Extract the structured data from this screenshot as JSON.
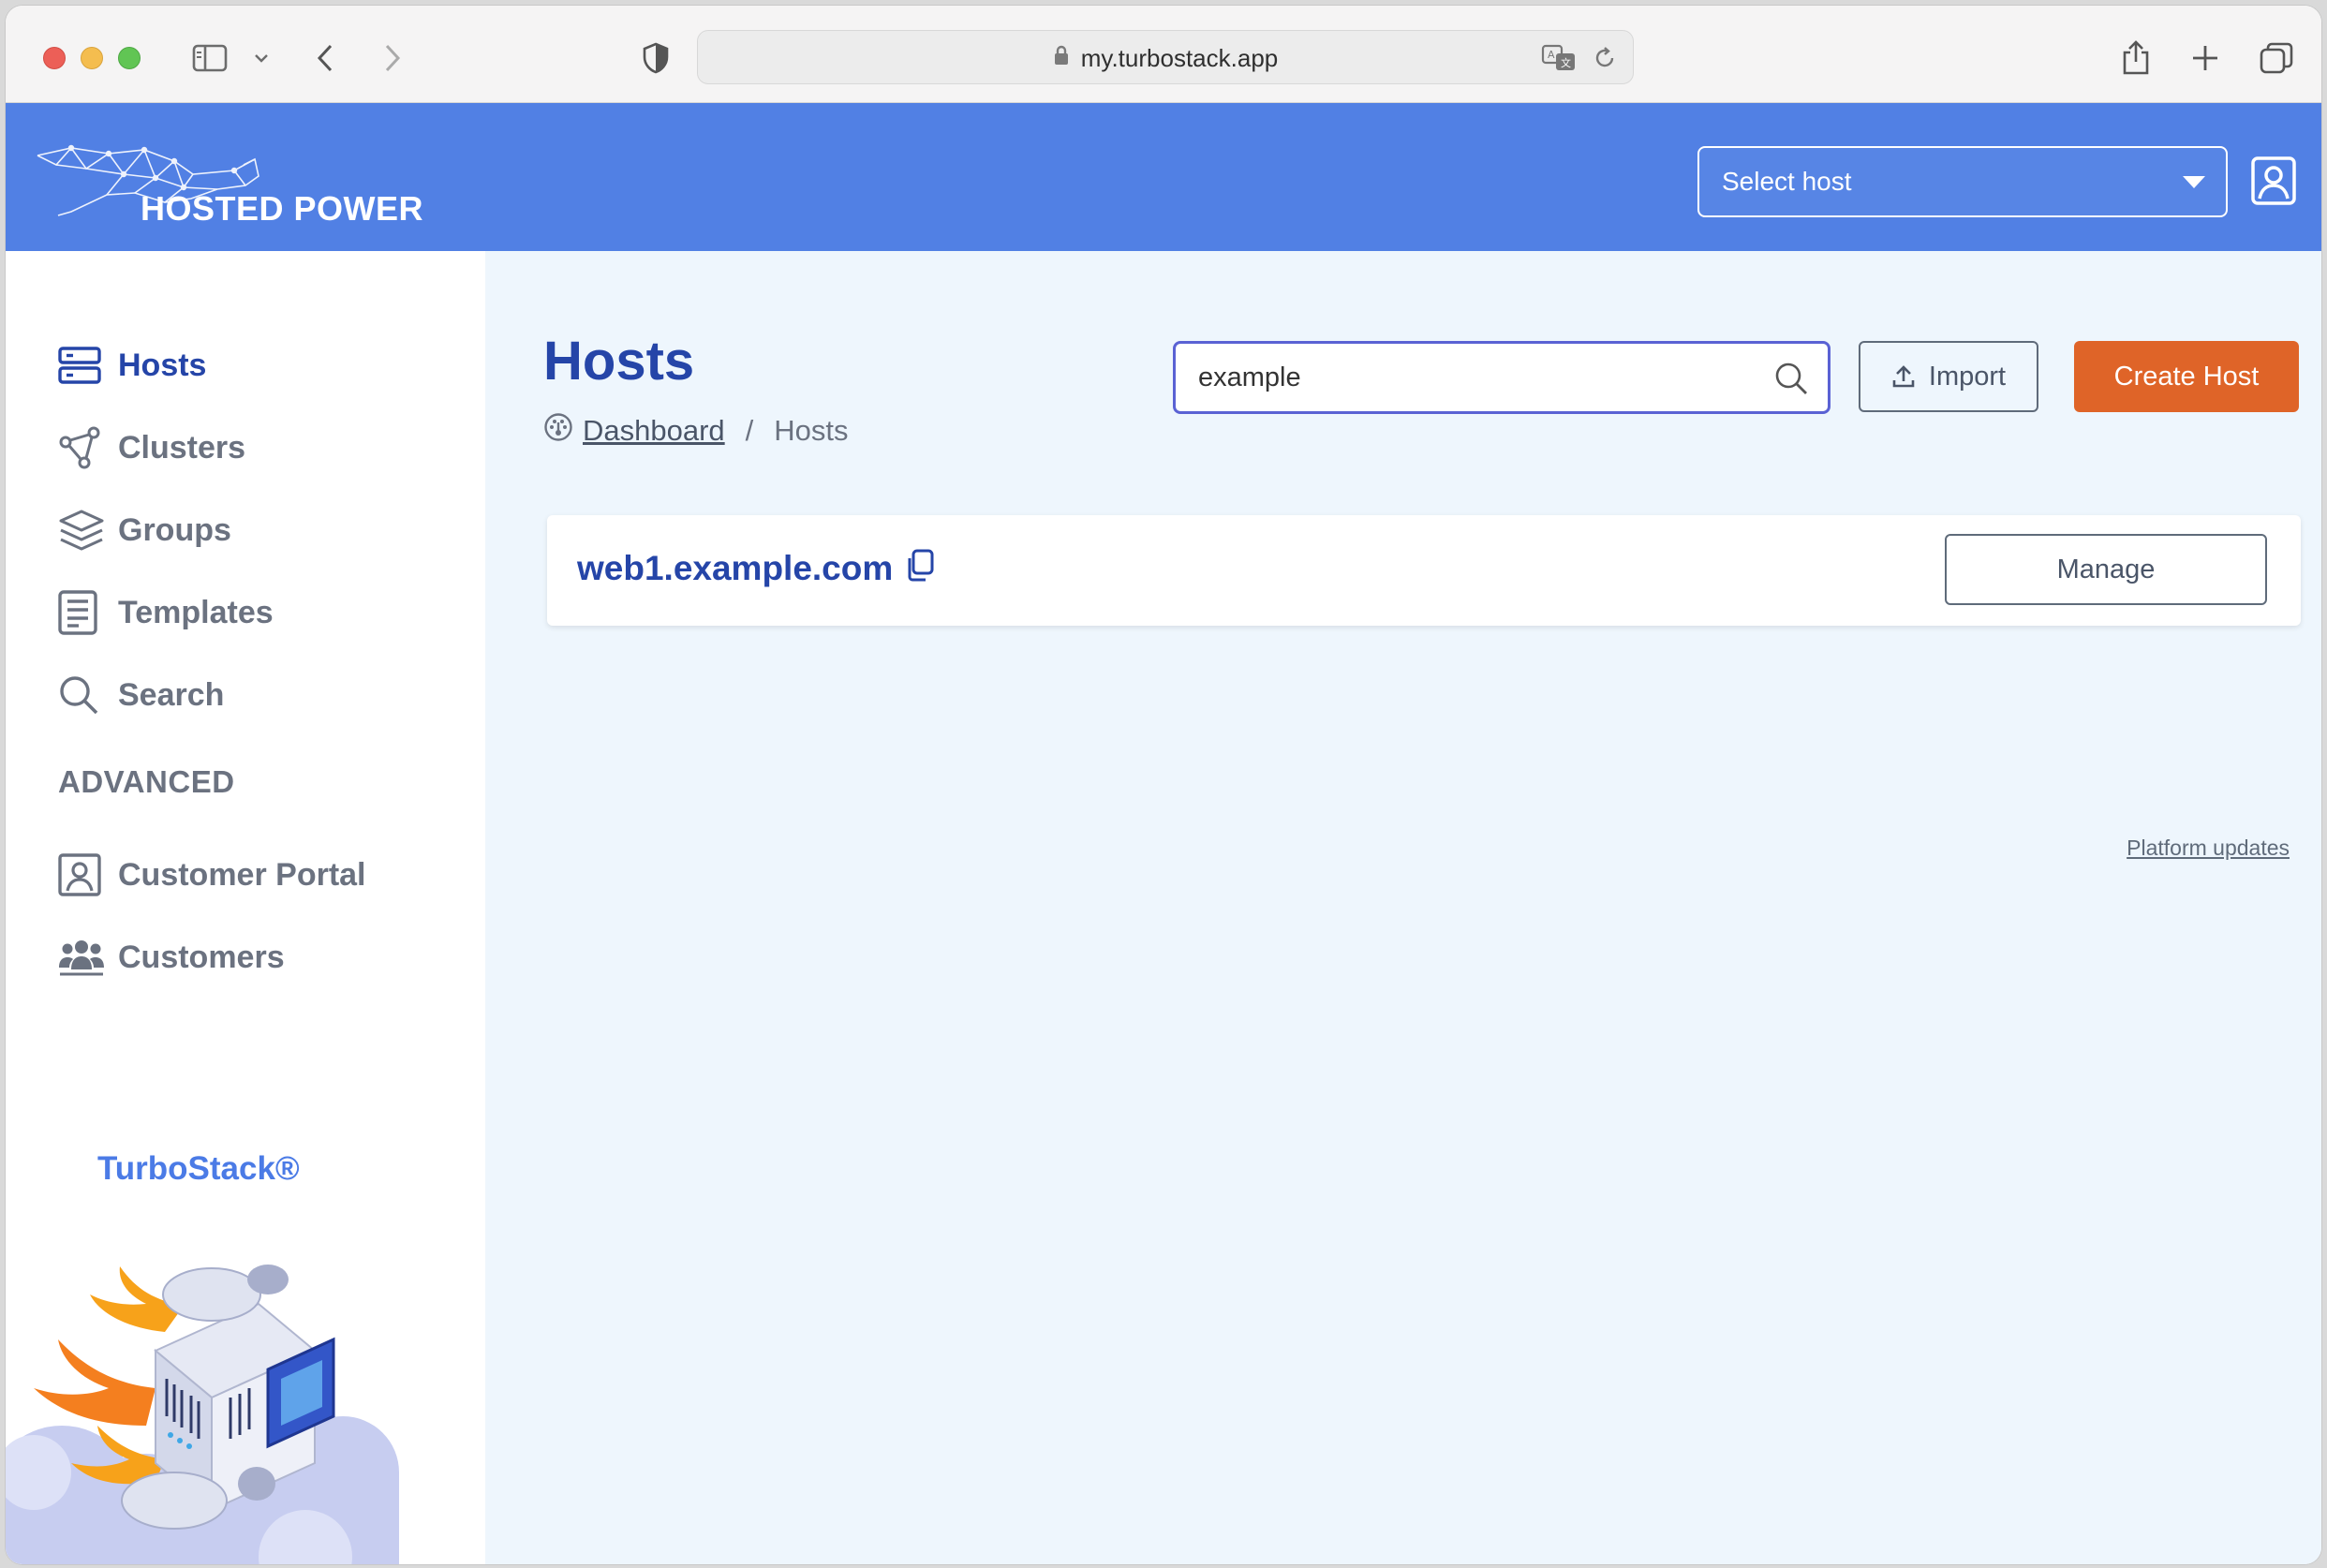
{
  "browser": {
    "url": "my.turbostack.app"
  },
  "header": {
    "logo_text": "HOSTED POWER",
    "host_select_label": "Select host"
  },
  "sidebar": {
    "items": [
      {
        "label": "Hosts",
        "icon": "server-icon",
        "active": true
      },
      {
        "label": "Clusters",
        "icon": "cluster-icon",
        "active": false
      },
      {
        "label": "Groups",
        "icon": "layers-icon",
        "active": false
      },
      {
        "label": "Templates",
        "icon": "template-icon",
        "active": false
      },
      {
        "label": "Search",
        "icon": "search-icon",
        "active": false
      }
    ],
    "advanced_title": "ADVANCED",
    "advanced_items": [
      {
        "label": "Customer Portal",
        "icon": "portrait-icon"
      },
      {
        "label": "Customers",
        "icon": "users-icon"
      }
    ],
    "brand": "TurboStack®"
  },
  "main": {
    "title": "Hosts",
    "breadcrumb": {
      "dashboard": "Dashboard",
      "separator": "/",
      "current": "Hosts"
    },
    "search": {
      "value": "example"
    },
    "import_label": "Import",
    "create_label": "Create Host",
    "hosts": [
      {
        "name": "web1.example.com",
        "action": "Manage"
      }
    ],
    "platform_updates": "Platform updates"
  },
  "colors": {
    "header_bg": "#5180e4",
    "accent_blue": "#2545a8",
    "create_btn": "#df6428",
    "main_bg": "#eef6fd"
  }
}
